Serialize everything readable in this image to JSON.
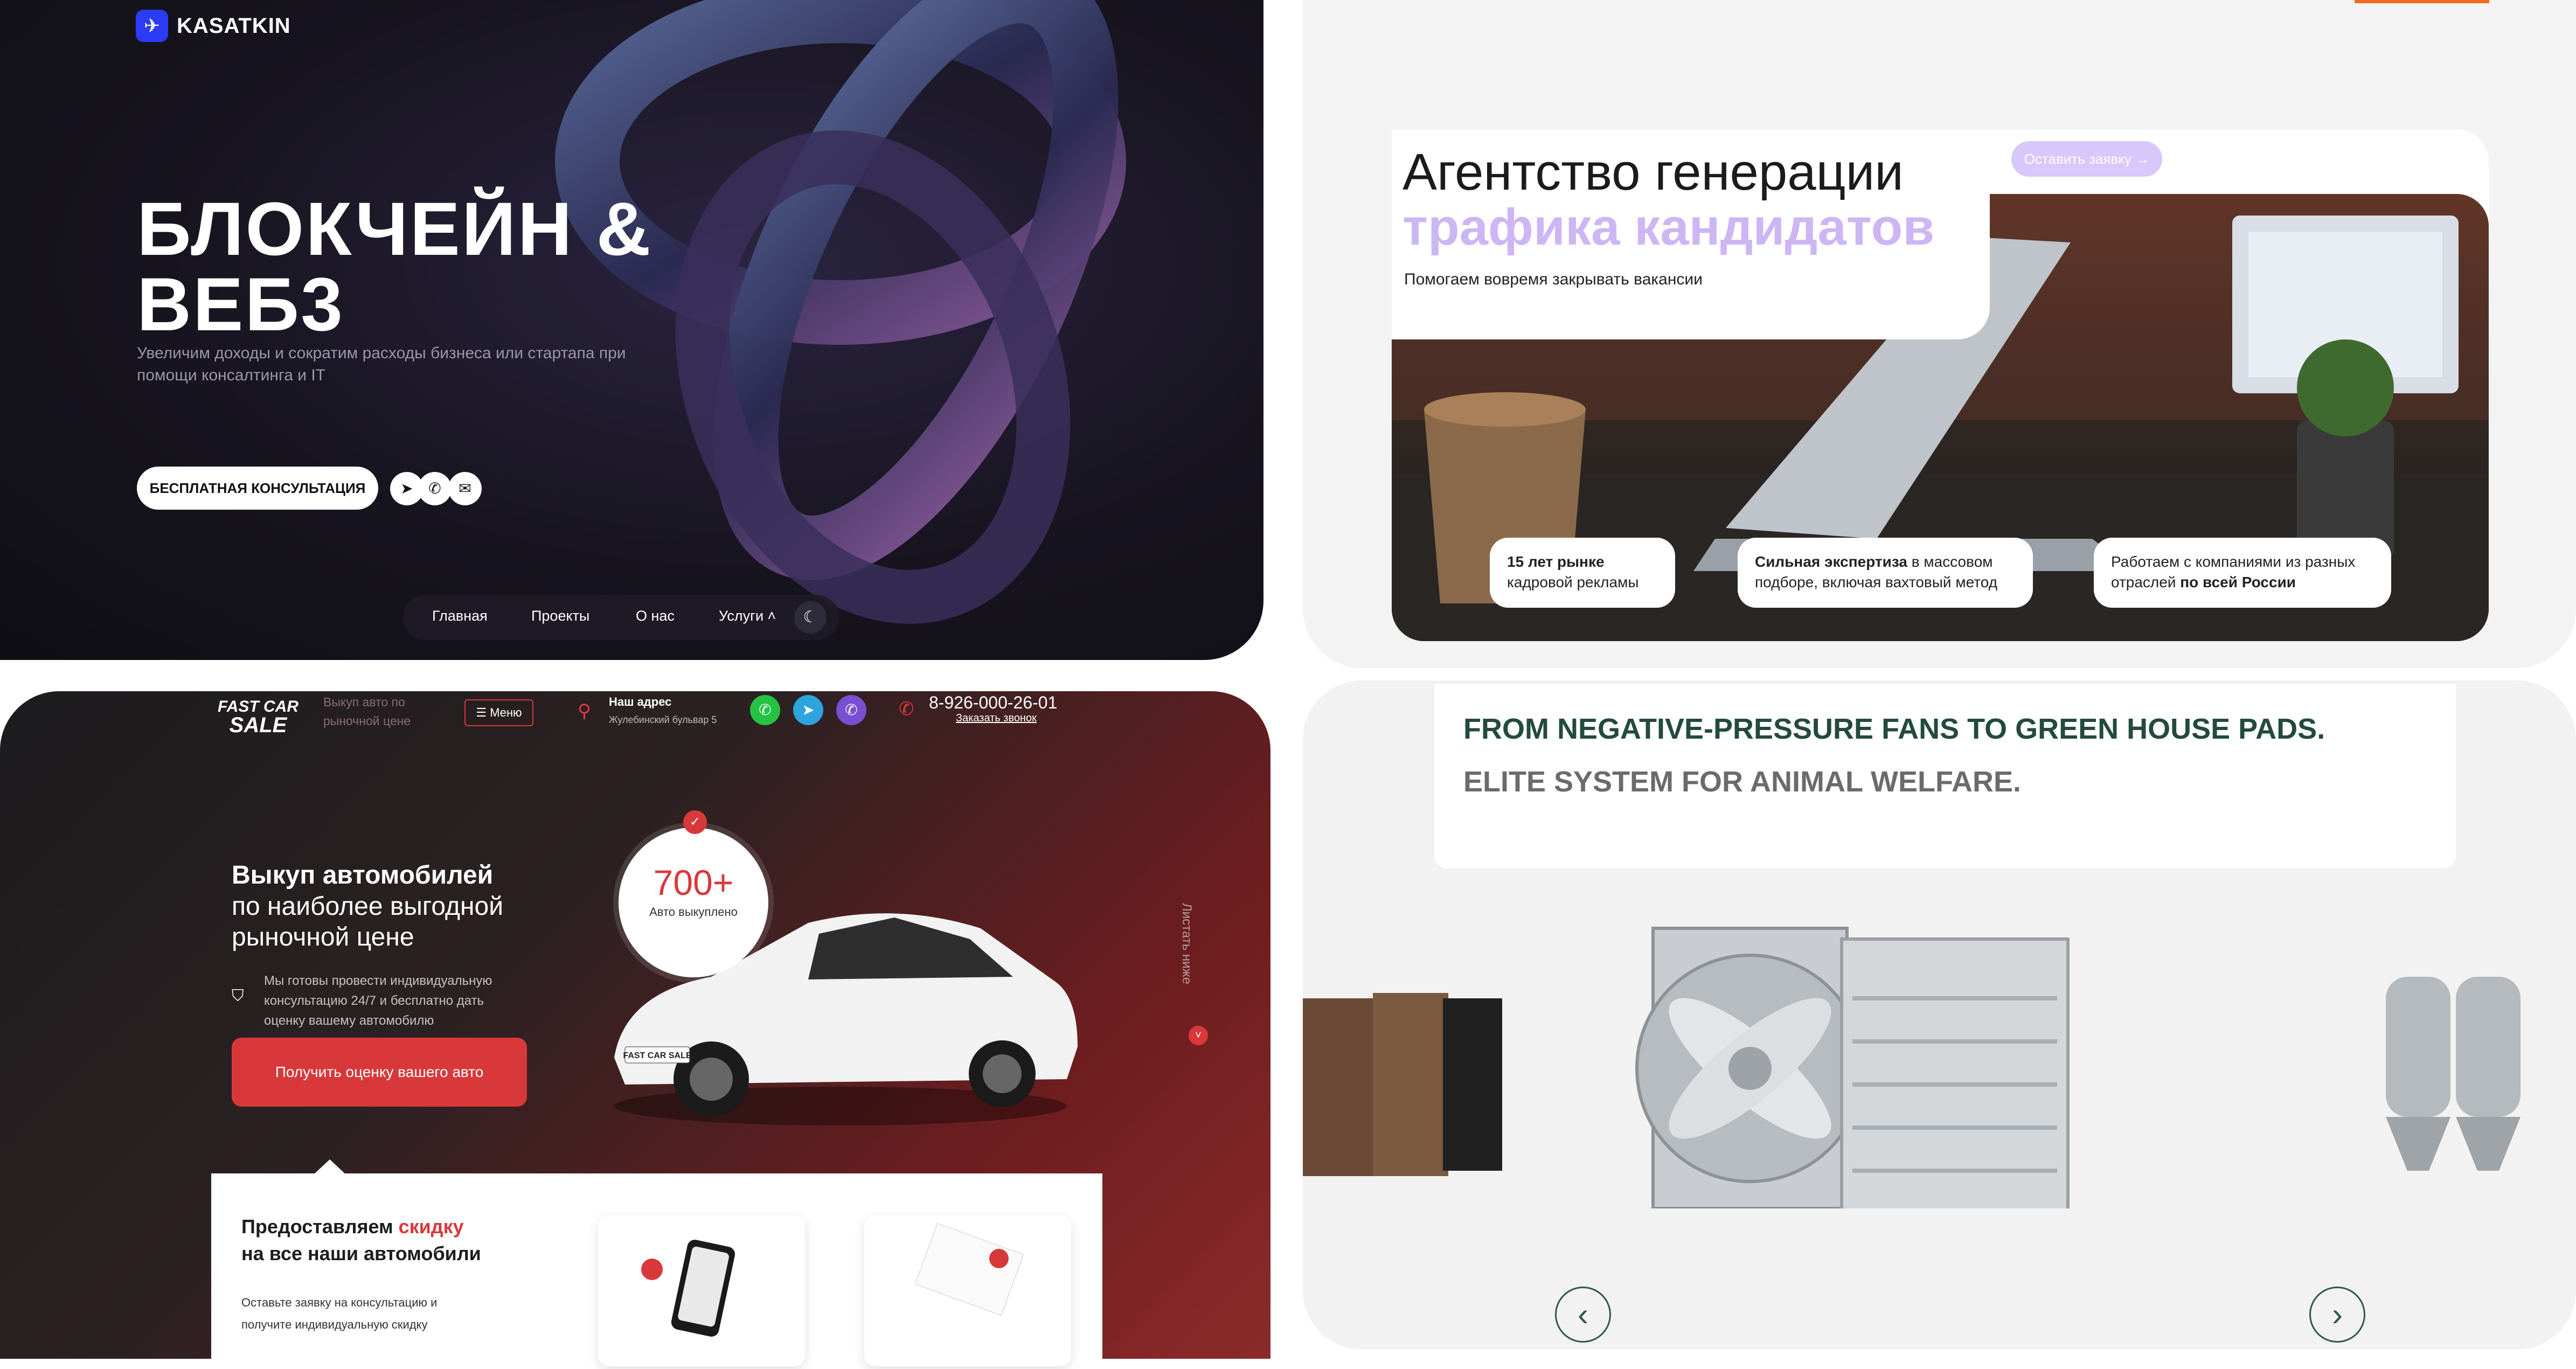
{
  "colors": {
    "p1_bg": "#17141f",
    "p2_accent": "#cdb6f4",
    "p3_accent": "#d9383b",
    "p4_heading": "#234a3e"
  },
  "panel1": {
    "brand": "KASATKIN",
    "title_line1": "БЛОКЧЕЙН &",
    "title_line2": "ВЕБ3",
    "subtitle": "Увеличим доходы и сократим расходы бизнеса или стартапа при помощи консалтинга и IT",
    "cta": "БЕСПЛАТНАЯ КОНСУЛЬТАЦИЯ",
    "social_icons": [
      "telegram-icon",
      "whatsapp-icon",
      "mail-icon"
    ],
    "nav": [
      "Главная",
      "Проекты",
      "О нас",
      "Услуги"
    ],
    "theme_icon": "moon-icon"
  },
  "panel2": {
    "heading_line1": "Агентство генерации",
    "heading_line2": "трафика кандидатов",
    "subheading": "Помогаем вовремя закрывать вакансии",
    "pill": "Оставить заявку →",
    "stats": [
      {
        "bold": "15 лет рынке",
        "rest": "кадровой рекламы"
      },
      {
        "bold": "Сильная экспертиза",
        "rest": " в массовом подборе, включая вахтовый метод"
      },
      {
        "pre": "Работаем с компаниями из разных отраслей ",
        "bold": "по всей России"
      }
    ]
  },
  "panel3": {
    "logo_line1": "FAST CAR",
    "logo_line2": "SALE",
    "tagline": "Выкуп авто по рыночной цене",
    "menu": "Меню",
    "address_label": "Наш адрес",
    "address_value": "Жулебинский бульвар 5",
    "phone": "8-926-000-26-01",
    "callback": "Заказать звонок",
    "messengers": [
      "whatsapp-icon",
      "telegram-icon",
      "viber-icon"
    ],
    "heading_bold": "Выкуп автомобилей",
    "heading_rest": "по наиболее выгодной рыночной цене",
    "text": "Мы готовы провести индивидуальную консультацию 24/7 и бесплатно дать оценку вашему автомобилю",
    "button": "Получить оценку вашего авто",
    "counter_value": "700+",
    "counter_label": "Авто выкуплено",
    "side_label": "Листать ниже",
    "plate": "FAST CAR SALE",
    "offer_pre": "Предоставляем ",
    "offer_accent": "скидку",
    "offer_line2": "на все наши автомобили",
    "offer_text": "Оставьте заявку на консультацию и получите индивидуальную скидку"
  },
  "panel4": {
    "heading1": "FROM NEGATIVE-PRESSURE FANS TO GREEN  HOUSE PADS.",
    "heading2": "ELITE SYSTEM FOR ANIMAL WELFARE.",
    "prev_icon": "chevron-left-icon",
    "next_icon": "chevron-right-icon"
  }
}
